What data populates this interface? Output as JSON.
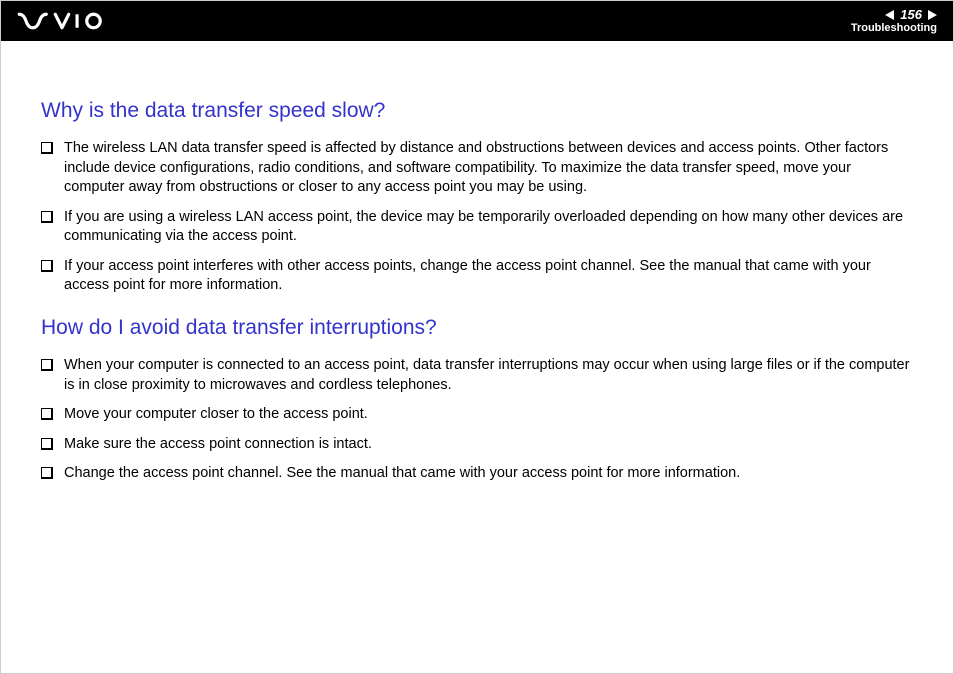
{
  "header": {
    "page_number": "156",
    "section": "Troubleshooting"
  },
  "sections": [
    {
      "heading": "Why is the data transfer speed slow?",
      "items": [
        "The wireless LAN data transfer speed is affected by distance and obstructions between devices and access points. Other factors include device configurations, radio conditions, and software compatibility. To maximize the data transfer speed, move your computer away from obstructions or closer to any access point you may be using.",
        "If you are using a wireless LAN access point, the device may be temporarily overloaded depending on how many other devices are communicating via the access point.",
        "If your access point interferes with other access points, change the access point channel. See the manual that came with your access point for more information."
      ]
    },
    {
      "heading": "How do I avoid data transfer interruptions?",
      "items": [
        "When your computer is connected to an access point, data transfer interruptions may occur when using large files or if the computer is in close proximity to microwaves and cordless telephones.",
        "Move your computer closer to the access point.",
        "Make sure the access point connection is intact.",
        "Change the access point channel. See the manual that came with your access point for more information."
      ]
    }
  ]
}
